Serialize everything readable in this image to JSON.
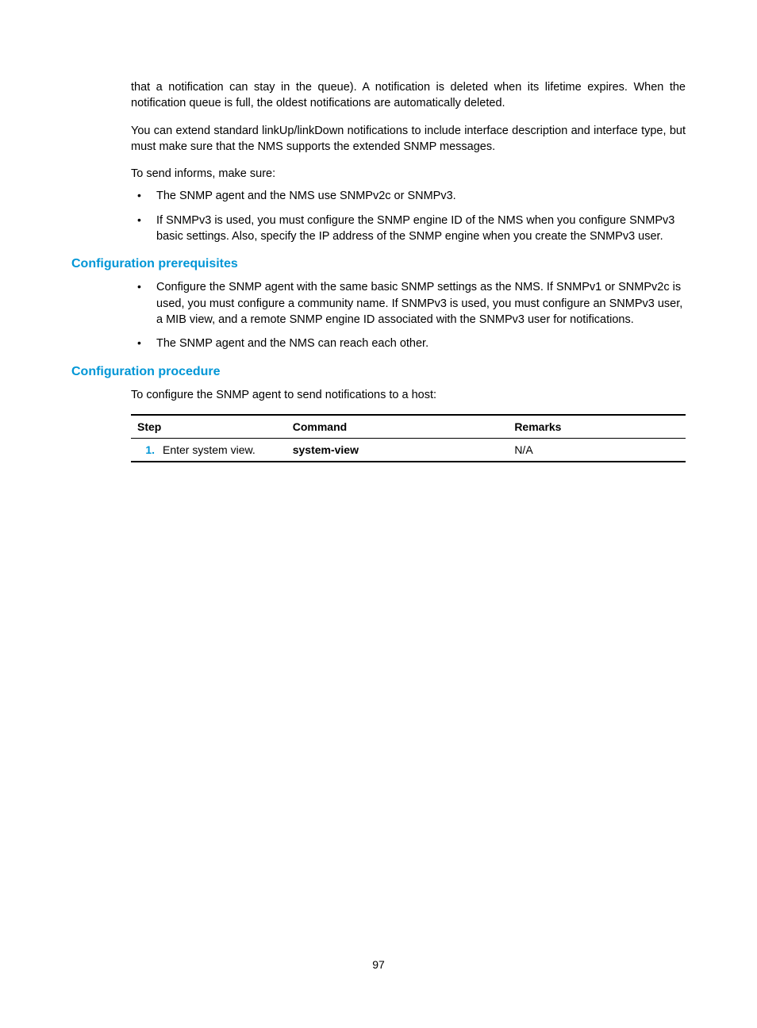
{
  "intro": {
    "p1": "that a notification can stay in the queue). A notification is deleted when its lifetime expires. When the notification queue is full, the oldest notifications are automatically deleted.",
    "p2": "You can extend standard linkUp/linkDown notifications to include interface description and interface type, but must make sure that the NMS supports the extended SNMP messages.",
    "p3": "To send informs, make sure:",
    "bullets": [
      "The SNMP agent and the NMS use SNMPv2c or SNMPv3.",
      "If SNMPv3 is used, you must configure the SNMP engine ID of the NMS when you configure SNMPv3 basic settings. Also, specify the IP address of the SNMP engine when you create the SNMPv3 user."
    ]
  },
  "prereq": {
    "heading": "Configuration prerequisites",
    "bullets": [
      "Configure the SNMP agent with the same basic SNMP settings as the NMS. If SNMPv1 or SNMPv2c is used, you must configure a community name. If SNMPv3 is used, you must configure an SNMPv3 user, a MIB view, and a remote SNMP engine ID associated with the SNMPv3 user for notifications.",
      "The SNMP agent and the NMS can reach each other."
    ]
  },
  "procedure": {
    "heading": "Configuration procedure",
    "intro": "To configure the SNMP agent to send notifications to a host:",
    "table": {
      "headers": {
        "step": "Step",
        "command": "Command",
        "remarks": "Remarks"
      },
      "rows": [
        {
          "num": "1.",
          "step": "Enter system view.",
          "command": "system-view",
          "remarks": "N/A"
        }
      ]
    }
  },
  "pageNumber": "97"
}
